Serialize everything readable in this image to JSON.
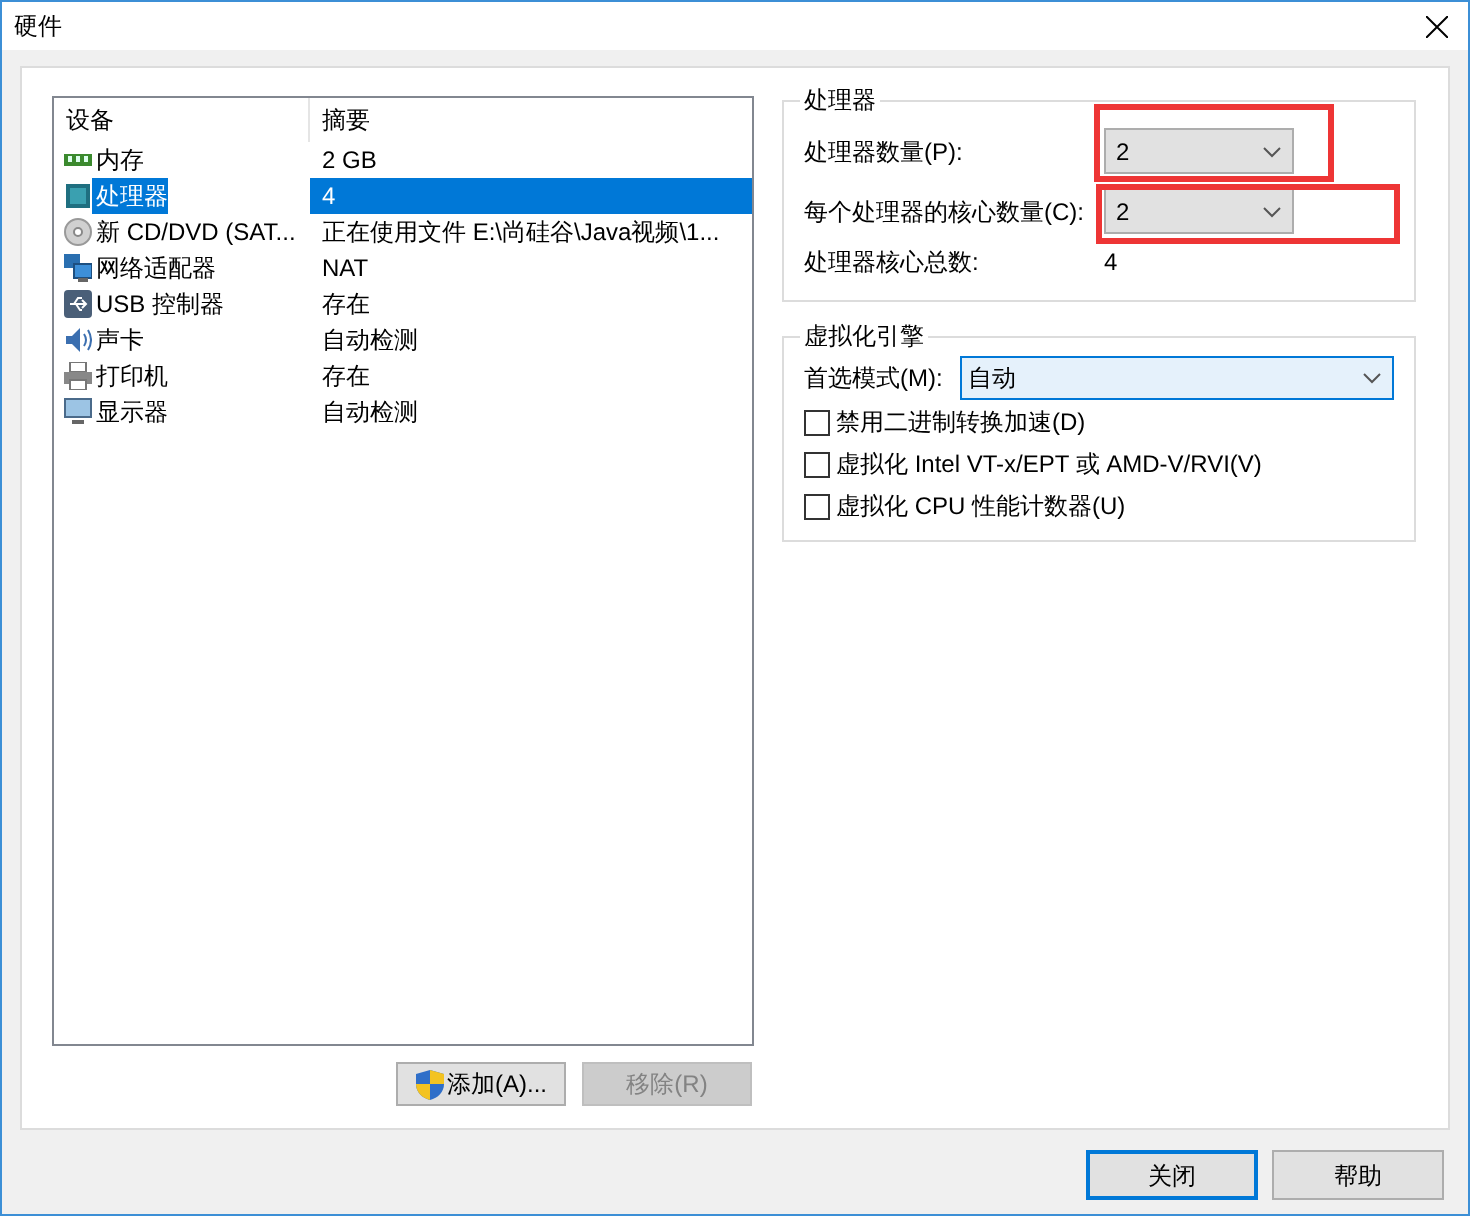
{
  "window": {
    "title": "硬件"
  },
  "device_list": {
    "columns": [
      "设备",
      "摘要"
    ],
    "rows": [
      {
        "kind": "memory",
        "device": "内存",
        "summary": "2 GB",
        "selected": false
      },
      {
        "kind": "cpu",
        "device": "处理器",
        "summary": "4",
        "selected": true
      },
      {
        "kind": "disc",
        "device": "新 CD/DVD (SAT...",
        "summary": "正在使用文件 E:\\尚硅谷\\Java视频\\1...",
        "selected": false
      },
      {
        "kind": "network",
        "device": "网络适配器",
        "summary": "NAT",
        "selected": false
      },
      {
        "kind": "usb",
        "device": "USB 控制器",
        "summary": "存在",
        "selected": false
      },
      {
        "kind": "sound",
        "device": "声卡",
        "summary": "自动检测",
        "selected": false
      },
      {
        "kind": "printer",
        "device": "打印机",
        "summary": "存在",
        "selected": false
      },
      {
        "kind": "display",
        "device": "显示器",
        "summary": "自动检测",
        "selected": false
      }
    ]
  },
  "list_buttons": [
    {
      "kind": "add",
      "label": "添加(A)...",
      "disabled": false
    },
    {
      "kind": "remove",
      "label": "移除(R)",
      "disabled": true
    }
  ],
  "processor_group": {
    "title": "处理器",
    "processor_count": {
      "label": "处理器数量(P):",
      "value": "2",
      "highlighted": true
    },
    "cores_per_processor": {
      "label": "每个处理器的核心数量(C):",
      "value": "2",
      "highlighted": true
    },
    "total_cores": {
      "label": "处理器核心总数:",
      "value": "4"
    }
  },
  "virtualization_group": {
    "title": "虚拟化引擎",
    "preferred_mode": {
      "label": "首选模式(M):",
      "value": "自动"
    },
    "options": [
      {
        "label": "禁用二进制转换加速(D)",
        "checked": false
      },
      {
        "label": "虚拟化 Intel VT-x/EPT 或 AMD-V/RVI(V)",
        "checked": false
      },
      {
        "label": "虚拟化 CPU 性能计数器(U)",
        "checked": false
      }
    ]
  },
  "footer_buttons": [
    {
      "label": "关闭",
      "default": true
    },
    {
      "label": "帮助",
      "default": false
    }
  ]
}
